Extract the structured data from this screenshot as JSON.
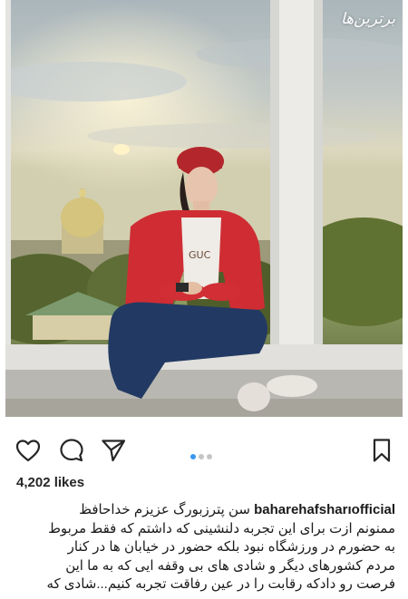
{
  "watermark": "برترین‌ها",
  "post": {
    "carousel": {
      "count": 3,
      "active": 0
    },
    "likes": "4,202 likes",
    "username": "baharehafsharıofficial",
    "caption_first": "سن پترزبورگ عزیزم خداحافظ",
    "caption_lines": [
      "ممنونم ازت برای این تجربه دلنشینی که داشتم که فقط مربوط",
      "به حضورم در ورزشگاه نبود  بلکه حضور در خیابان ها در کنار",
      "مردم کشورهای دیگر و  شادی های بی وقفه ایی که به ما این",
      "فرصت  رو دادکه رقابت را در عین رفاقت تجربه کنیم...شادی که"
    ]
  },
  "icons": {
    "like": "heart-icon",
    "comment": "comment-bubble-icon",
    "share": "paper-plane-icon",
    "save": "bookmark-icon"
  }
}
